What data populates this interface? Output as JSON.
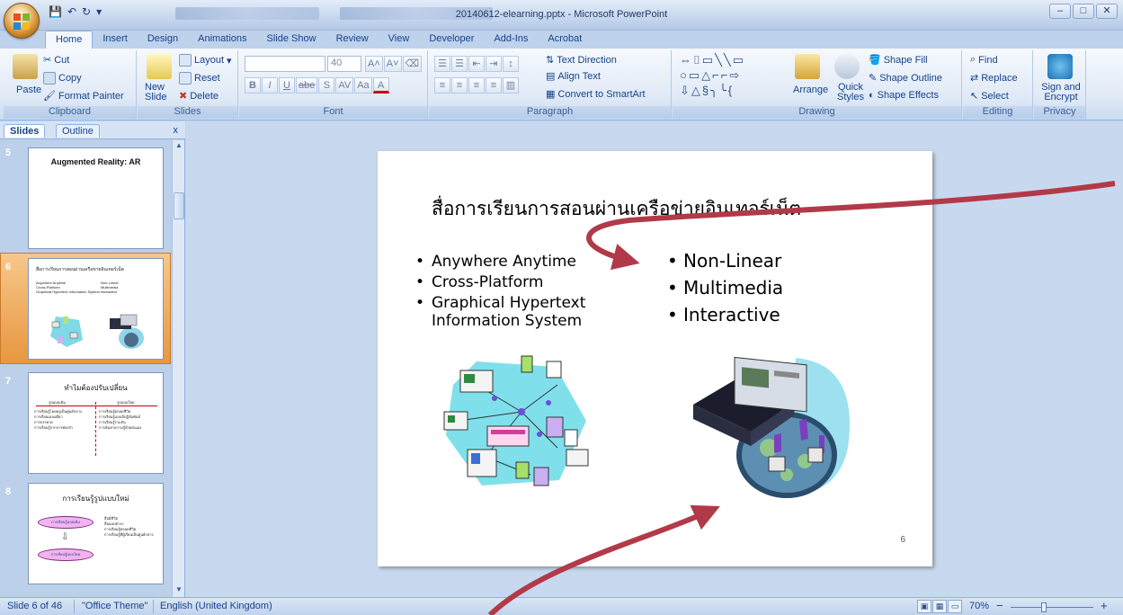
{
  "window": {
    "title": "20140612-elearning.pptx - Microsoft PowerPoint",
    "controls": [
      "–",
      "□",
      "✕"
    ]
  },
  "ribbon_tabs": [
    "Home",
    "Insert",
    "Design",
    "Animations",
    "Slide Show",
    "Review",
    "View",
    "Developer",
    "Add-Ins",
    "Acrobat"
  ],
  "clipboard": {
    "label": "Clipboard",
    "paste": "Paste",
    "cut": "Cut",
    "copy": "Copy",
    "format_painter": "Format Painter"
  },
  "slides_group": {
    "label": "Slides",
    "new_slide": "New Slide",
    "layout": "Layout",
    "reset": "Reset",
    "delete": "Delete"
  },
  "font_group": {
    "label": "Font",
    "size": "40",
    "bold": "B",
    "italic": "I",
    "underline": "U",
    "strike": "abe",
    "shadow": "S",
    "spacing": "AV",
    "case": "Aa",
    "color": "A"
  },
  "paragraph_group": {
    "label": "Paragraph",
    "text_direction": "Text Direction",
    "align_text": "Align Text",
    "convert_smartart": "Convert to SmartArt"
  },
  "drawing_group": {
    "label": "Drawing",
    "arrange": "Arrange",
    "quick_styles": "Quick Styles",
    "shape_fill": "Shape Fill",
    "shape_outline": "Shape Outline",
    "shape_effects": "Shape Effects"
  },
  "editing_group": {
    "label": "Editing",
    "find": "Find",
    "replace": "Replace",
    "select": "Select"
  },
  "privacy_group": {
    "label": "Privacy",
    "sign_encrypt": "Sign and Encrypt"
  },
  "pane": {
    "tab_slides": "Slides",
    "tab_outline": "Outline",
    "close": "x",
    "thumbs": [
      {
        "num": "5",
        "title": "Augmented Reality: AR"
      },
      {
        "num": "6",
        "title": "สื่อการเรียนการสอนผ่านเครือข่ายอินเทอร์เน็ต",
        "left": [
          "Anywhere Anytime",
          "Cross-Platform",
          "Graphical Hypertext Information System"
        ],
        "right": [
          "Non-Linear",
          "Multimedia",
          "Interactive"
        ]
      },
      {
        "num": "7",
        "title": "ทำไมต้องปรับเปลี่ยน",
        "left_head": "รูปแบบเดิม",
        "right_head": "รูปแบบใหม่",
        "left": [
          "การเรียนรู้โดยครูเป็นศูนย์กลาง",
          "การเรียนแบบเดี่ยว",
          "การบรรยาย",
          "การเรียนรู้จากการท่องจำ"
        ],
        "right": [
          "การเรียนรู้ตลอดชีวิต",
          "การเรียนรู้แบบมีปฏิสัมพันธ์",
          "การเรียนรู้ร่วมกัน",
          "การค้นหาความรู้ด้วยตนเอง"
        ]
      },
      {
        "num": "8",
        "title": "การเรียนรู้รูปแบบใหม่",
        "oval_top": "การเรียนรู้แบบเดิม",
        "oval_bottom": "การเรียนรู้แบบใหม่",
        "right": [
          "สื่อมีชีวิต",
          "สื่อแบบต่างๆ",
          "การเรียนรู้ตลอดชีวิต",
          "การเรียนรู้ที่ผู้เรียนเป็นศูนย์กลาง"
        ]
      }
    ]
  },
  "slide": {
    "title": "สื่อการเรียนการสอนผ่านเครือข่ายอินเทอร์เน็ต",
    "left_bullets": [
      "Anywhere Anytime",
      "Cross-Platform",
      "Graphical Hypertext Information System"
    ],
    "right_bullets": [
      "Non-Linear",
      "Multimedia",
      "Interactive"
    ],
    "page_number": "6"
  },
  "status": {
    "slide_info": "Slide 6 of 46",
    "theme": "\"Office Theme\"",
    "language": "English (United Kingdom)",
    "zoom": "70%",
    "zoom_out": "−",
    "zoom_in": "+"
  },
  "colors": {
    "accent_arrow": "#b23a48",
    "selected_thumb": "#e8973f",
    "ribbon": "#dfe9f6"
  }
}
